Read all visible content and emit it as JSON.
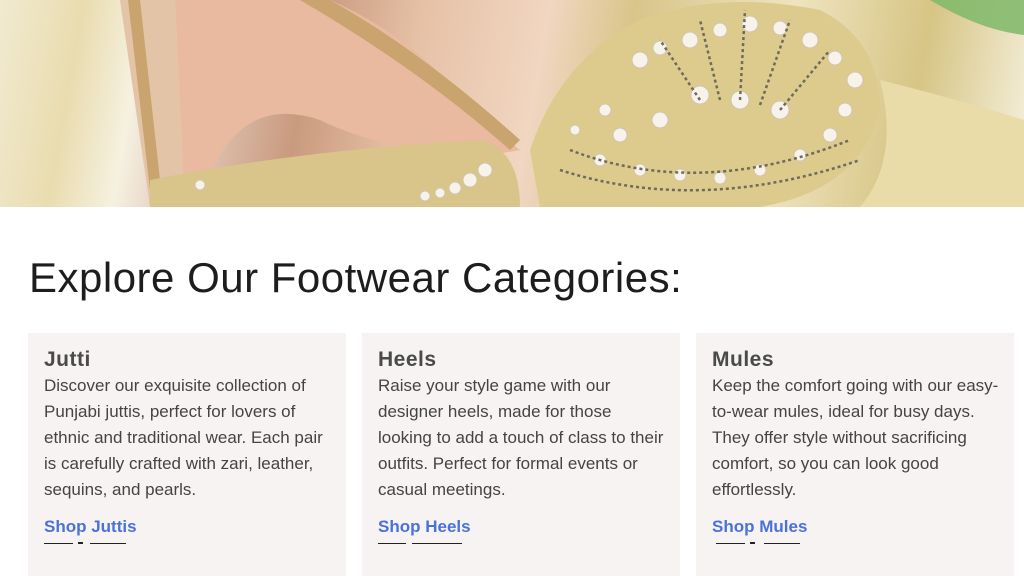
{
  "hero": {
    "image_label": "pearl-embellished-heels-photo",
    "colors": {
      "gold": "#d8c483",
      "blush": "#e7b79c",
      "pearl": "#f5f1ea",
      "bead": "#6f6a5e"
    }
  },
  "section": {
    "heading": "Explore Our Footwear Categories:"
  },
  "cards": [
    {
      "title": "Jutti",
      "description": "Discover our exquisite collection of Punjabi juttis, perfect for lovers of ethnic and traditional wear. Each pair is carefully crafted with zari, leather, sequins, and pearls.",
      "link": "Shop Juttis"
    },
    {
      "title": "Heels",
      "description": "Raise your style game with our designer heels, made for those looking to add a touch of class to their outfits. Perfect for formal events or casual meetings.",
      "link": "Shop Heels"
    },
    {
      "title": "Mules",
      "description": "Keep the comfort going with our easy-to-wear mules, ideal for busy days. They offer style without sacrificing comfort, so you can look good effortlessly.",
      "link": "Shop Mules"
    }
  ],
  "theme": {
    "link_color": "#4a72d9",
    "card_bg": "#f7f3f2",
    "heading_color": "#1d1d1d"
  }
}
